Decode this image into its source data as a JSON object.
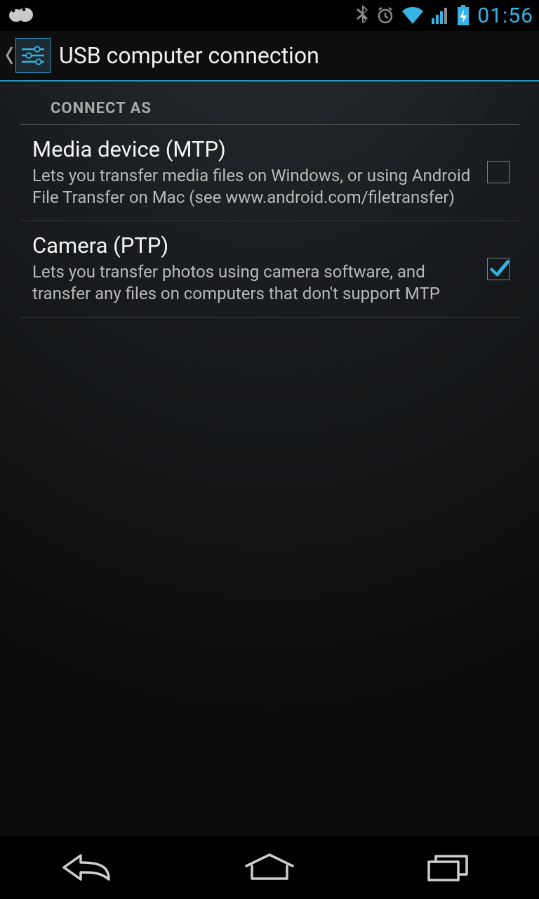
{
  "status": {
    "time": "01:56"
  },
  "header": {
    "title": "USB computer connection"
  },
  "section": {
    "label": "CONNECT AS"
  },
  "options": [
    {
      "title": "Media device (MTP)",
      "desc": "Lets you transfer media files on Windows, or using Android File Transfer on Mac (see www.android.com/filetransfer)",
      "checked": false
    },
    {
      "title": "Camera (PTP)",
      "desc": "Lets you transfer photos using camera software, and transfer any files on computers that don't support MTP",
      "checked": true
    }
  ]
}
